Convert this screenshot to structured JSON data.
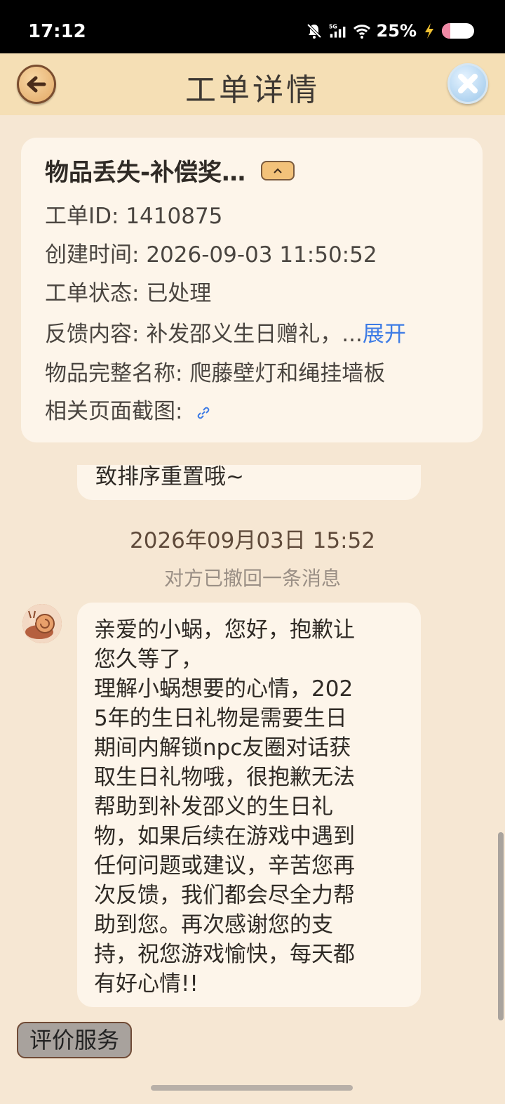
{
  "status_bar": {
    "time": "17:12",
    "battery_text": "25%",
    "battery_level": 0.25,
    "icons": [
      "mute-bell-icon",
      "5g-signal-icon",
      "wifi-icon",
      "charging-icon",
      "battery-icon"
    ]
  },
  "header": {
    "title": "工单详情",
    "back_icon": "back-arrow-icon",
    "close_icon": "close-icon"
  },
  "ticket": {
    "title": "物品丢失-补偿奖…",
    "id_label": "工单ID:",
    "id_value": "1410875",
    "created_label": "创建时间:",
    "created_value": "2026-09-03 11:50:52",
    "status_label": "工单状态:",
    "status_value": "已处理",
    "feedback_label": "反馈内容:",
    "feedback_value": "补发邵义生日赠礼，...",
    "expand_label": "展开",
    "item_name_label": "物品完整名称:",
    "item_name_value": "爬藤壁灯和绳挂墙板",
    "screenshot_label": "相关页面截图:",
    "link_icon": "link-icon"
  },
  "chat": {
    "prev_bubble_tail": "致排序重置哦~",
    "timestamp": "2026年09月03日 15:52",
    "recall_notice": "对方已撤回一条消息",
    "message_lines": [
      "亲爱的小蜗，您好，抱歉让",
      "您久等了，",
      "理解小蜗想要的心情，202",
      "5年的生日礼物是需要生日",
      "期间内解锁npc友圈对话获",
      "取生日礼物哦，很抱歉无法",
      "帮助到补发邵义的生日礼",
      "物，如果后续在游戏中遇到",
      "任何问题或建议，辛苦您再",
      "次反馈，我们都会尽全力帮",
      "助到您。再次感谢您的支",
      "持，祝您游戏愉快，每天都",
      "有好心情!!"
    ]
  },
  "footer": {
    "rate_button": "评价服务"
  }
}
